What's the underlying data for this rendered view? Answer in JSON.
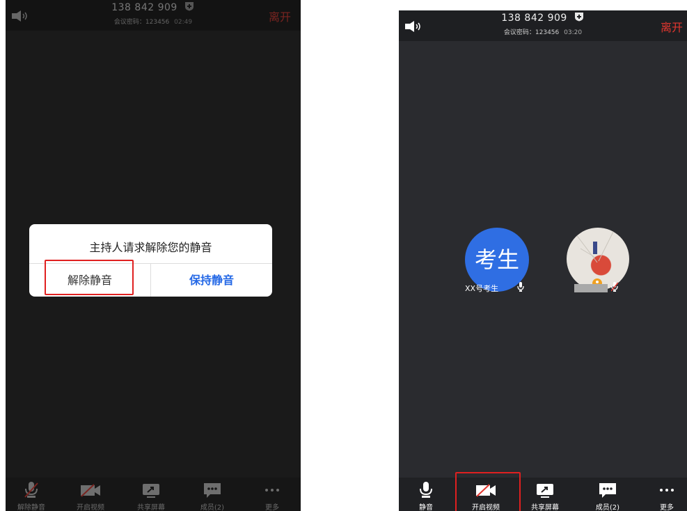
{
  "left_screen": {
    "meeting_id": "138 842 909",
    "meeting_password": "会议密码：123456",
    "elapsed": "02:49",
    "leave_label": "离开",
    "dialog": {
      "message": "主持人请求解除您的静音",
      "unmute_label": "解除静音",
      "keep_muted_label": "保持静音"
    },
    "toolbar": [
      {
        "icon": "mic-muted-icon",
        "label": "解除静音"
      },
      {
        "icon": "video-off-icon",
        "label": "开启视频"
      },
      {
        "icon": "share-screen-icon",
        "label": "共享屏幕"
      },
      {
        "icon": "members-icon",
        "label": "成员(2)"
      },
      {
        "icon": "more-icon",
        "label": "更多"
      }
    ]
  },
  "right_screen": {
    "meeting_id": "138 842 909",
    "meeting_password": "会议密码：123456",
    "elapsed": "03:20",
    "leave_label": "离开",
    "participants": [
      {
        "avatar_text": "考生",
        "name": "XX号考生",
        "mic": "mic-on-icon"
      },
      {
        "avatar_text": "",
        "name": "",
        "mic": "mic-muted-icon"
      }
    ],
    "toolbar": [
      {
        "icon": "mic-icon",
        "label": "静音"
      },
      {
        "icon": "video-off-icon",
        "label": "开启视频"
      },
      {
        "icon": "share-screen-icon",
        "label": "共享屏幕"
      },
      {
        "icon": "members-icon",
        "label": "成员(2)"
      },
      {
        "icon": "more-icon",
        "label": "更多"
      }
    ]
  },
  "colors": {
    "leave": "#e2362e",
    "accent_blue": "#2468e6",
    "avatar_blue": "#2f6ee3",
    "highlight_red": "#e02020"
  }
}
